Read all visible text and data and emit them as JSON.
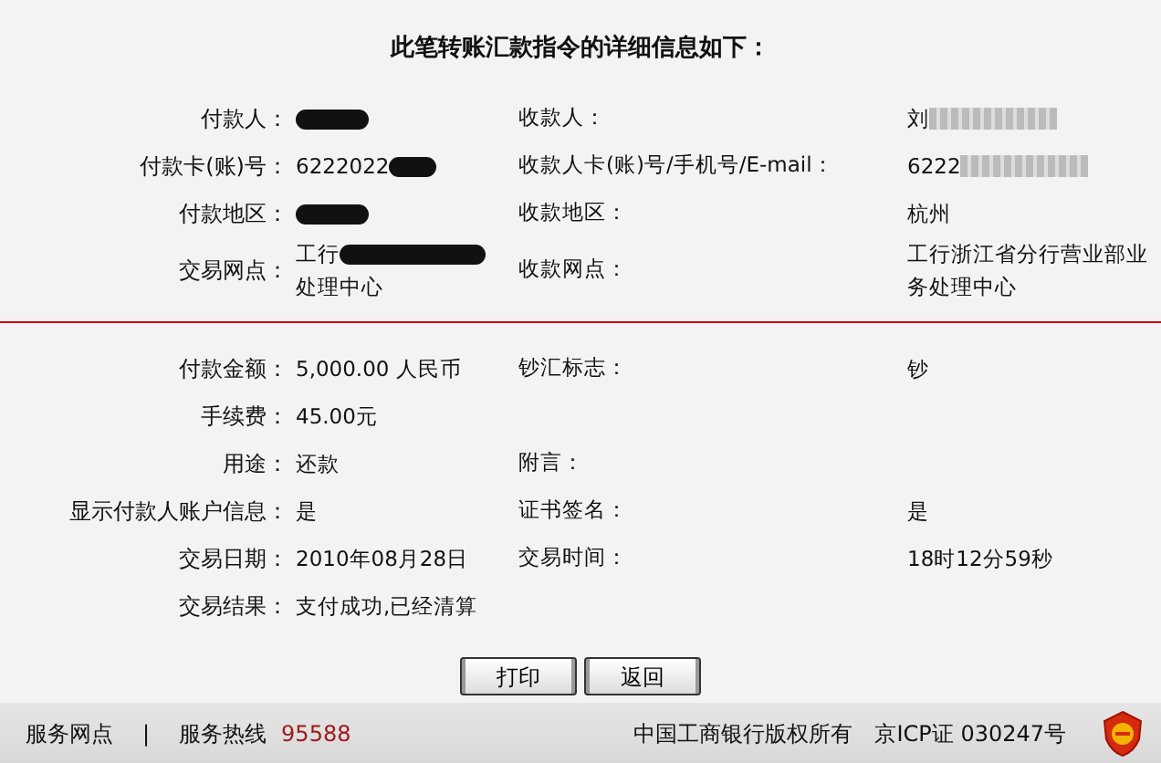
{
  "title": "此笔转账汇款指令的详细信息如下：",
  "sections": [
    {
      "rows": [
        {
          "label": "付款人：",
          "value_redacted": true,
          "label2": "收款人：",
          "value2": "刘",
          "value2_blurred": true
        },
        {
          "label": "付款卡(账)号：",
          "value": "6222022",
          "value_redacted": true,
          "label2": "收款人卡(账)号/手机号/E-mail：",
          "value2": "6222",
          "value2_blurred": true
        },
        {
          "label": "付款地区：",
          "value_redacted": true,
          "label2": "收款地区：",
          "value2": "杭州"
        },
        {
          "label": "交易网点：",
          "value": "工行",
          "value_redacted": true,
          "value_tail": "处理中心",
          "label2": "收款网点：",
          "value2": "工行浙江省分行营业部业务处理中心"
        }
      ]
    },
    {
      "rows": [
        {
          "label": "付款金额：",
          "value": "5,000.00 人民币",
          "label2": "钞汇标志：",
          "value2": "钞"
        },
        {
          "label": "手续费：",
          "value": "45.00元"
        },
        {
          "label": "用途：",
          "value": "还款",
          "label2": "附言："
        },
        {
          "label": "显示付款人账户信息：",
          "value": "是",
          "label2": "证书签名：",
          "value2": "是"
        },
        {
          "label": "交易日期：",
          "value": "2010年08月28日",
          "label2": "交易时间：",
          "value2": "18时12分59秒"
        },
        {
          "label": "交易结果：",
          "value": "支付成功,已经清算"
        }
      ]
    }
  ],
  "buttons": [
    "打印",
    "返回"
  ],
  "footer": {
    "left": [
      "服务网点",
      "|",
      "服务热线"
    ],
    "hotline": "95588",
    "copyright": "中国工商银行版权所有",
    "icp": "京ICP证 030247号"
  }
}
